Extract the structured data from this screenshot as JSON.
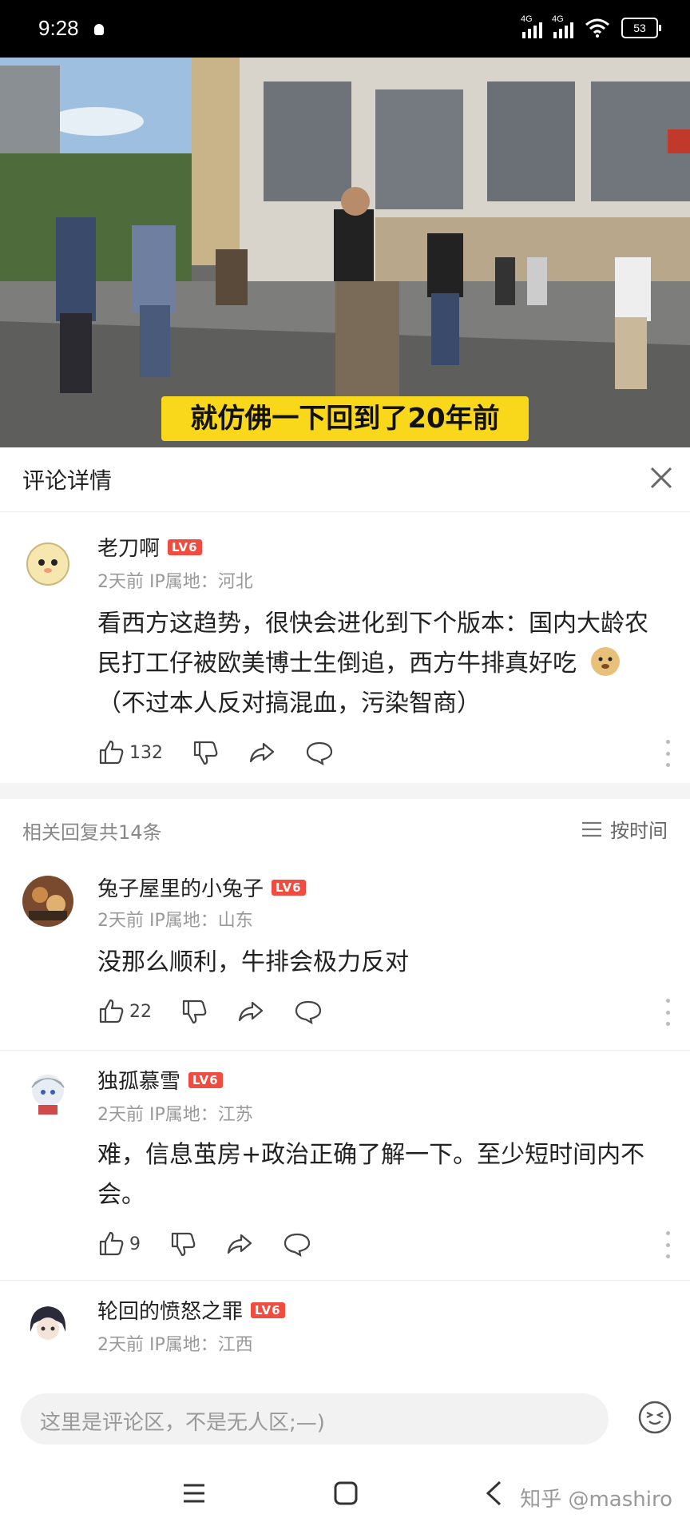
{
  "status_bar": {
    "time": "9:28",
    "signal_1_label": "4G",
    "signal_2_label": "4G",
    "battery": "53"
  },
  "video": {
    "caption": "就仿佛一下回到了20年前"
  },
  "panel": {
    "title": "评论详情"
  },
  "main_comment": {
    "author": "老刀啊",
    "level": "LV6",
    "meta": "2天前  IP属地：河北",
    "text": "看西方这趋势，很快会进化到下个版本：国内大龄农民打工仔被欧美博士生倒追，西方牛排真好吃",
    "text_tail": "（不过本人反对搞混血，污染智商）",
    "likes": "132"
  },
  "replies": {
    "count_label": "相关回复共14条",
    "sort_label": "按时间",
    "items": [
      {
        "author": "兔子屋里的小兔子",
        "level": "LV6",
        "meta": "2天前  IP属地：山东",
        "text": "没那么顺利，牛排会极力反对",
        "likes": "22"
      },
      {
        "author": "独孤慕雪",
        "level": "LV6",
        "meta": "2天前  IP属地：江苏",
        "text": "难，信息茧房+政治正确了解一下。至少短时间内不会。",
        "likes": "9"
      },
      {
        "author": "轮回的愤怒之罪",
        "level": "LV6",
        "meta": "2天前  IP属地：江西",
        "text": "",
        "likes": ""
      }
    ]
  },
  "input": {
    "placeholder": "这里是评论区，不是无人区;—)"
  },
  "watermark": "知乎 @mashiro",
  "colors": {
    "level_badge": "#f24b3f",
    "caption_bg": "#f9d71b"
  }
}
